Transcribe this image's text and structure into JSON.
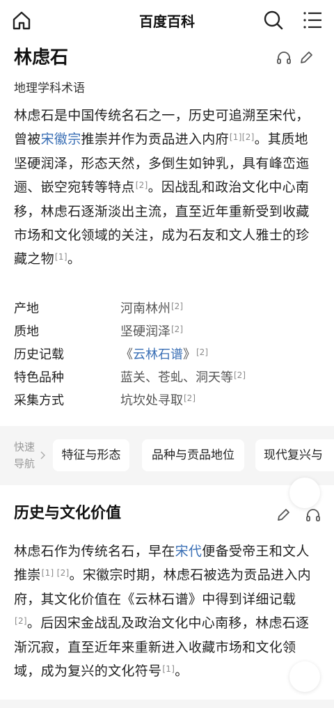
{
  "topbar": {
    "title": "百度百科"
  },
  "article": {
    "title": "林虑石",
    "subtitle": "地理学科术语",
    "intro": [
      {
        "t": "林虑石是中国传统名石之一，历史可追溯至宋代，曾被"
      },
      {
        "t": "宋徽宗",
        "link": true
      },
      {
        "t": "推崇并作为贡品进入内府"
      },
      {
        "t": "[1][2]",
        "sup": true
      },
      {
        "t": "。其质地坚硬润泽，形态天然，多倒生如钟乳，具有峰峦迤逦、嵌空宛转等特点"
      },
      {
        "t": "[2]",
        "sup": true
      },
      {
        "t": "。因战乱和政治文化中心南移，林虑石逐渐淡出主流，直至近年重新受到收藏市场和文化领域的关注，成为石友和文人雅士的珍藏之物"
      },
      {
        "t": "[1]",
        "sup": true
      },
      {
        "t": "。"
      }
    ]
  },
  "infobox": [
    {
      "key": "产地",
      "value": "河南林州",
      "ref": "[2]"
    },
    {
      "key": "质地",
      "value": "坚硬润泽",
      "ref": "[2]"
    },
    {
      "key": "历史记载",
      "value_pre": "《",
      "value_link": "云林石谱",
      "value_post": "》",
      "ref": "[2]"
    },
    {
      "key": "特色品种",
      "value": "蓝关、苍虬、洞天等",
      "ref": "[2]"
    },
    {
      "key": "采集方式",
      "value": "坑坎处寻取",
      "ref": "[2]"
    }
  ],
  "quicknav": {
    "label": "快速导航",
    "chips": [
      "特征与形态",
      "品种与贡品地位",
      "现代复兴与"
    ]
  },
  "section": {
    "title": "历史与文化价值",
    "body": [
      {
        "t": "林虑石作为传统名石，早在"
      },
      {
        "t": "宋代",
        "link": true
      },
      {
        "t": "便备受帝王和文人推崇"
      },
      {
        "t": "[1] [2]",
        "sup": true
      },
      {
        "t": "。宋徽宗时期，林虑石被选为贡品进入内府，其文化价值在《云林石谱》中得到详细记载"
      },
      {
        "t": "[2]",
        "sup": true
      },
      {
        "t": "。后因宋金战乱及政治文化中心南移，林虑石逐渐沉寂，直至近年来重新进入收藏市场和文化领域，成为复兴的文化符号"
      },
      {
        "t": "[1]",
        "sup": true
      },
      {
        "t": "。"
      }
    ]
  },
  "colors": {
    "link": "#3a6fb5",
    "ref": "#8a8a8a",
    "band": "#f5f5f5"
  },
  "icons": [
    "home-icon",
    "search-icon",
    "menu-icon",
    "headphones-icon",
    "edit-icon",
    "chevron-right-icon"
  ]
}
